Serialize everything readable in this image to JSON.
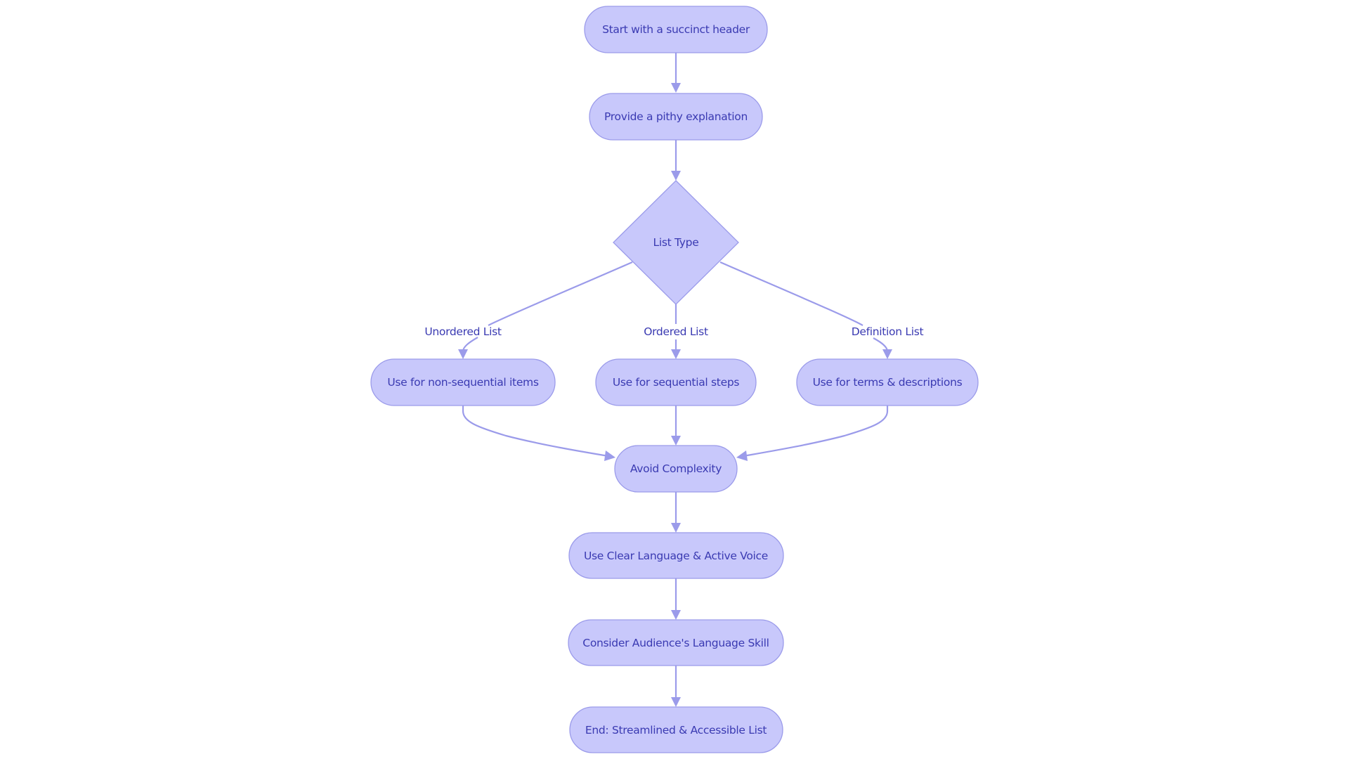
{
  "diagram": {
    "type": "flowchart",
    "direction": "top-down",
    "colors": {
      "node_fill": "#c8c8fb",
      "node_stroke": "#9b9bea",
      "text": "#3a3ab2",
      "edge": "#9b9bea",
      "background": "#ffffff"
    },
    "nodes": [
      {
        "id": "start",
        "label": "Start with a succinct header",
        "shape": "stadium"
      },
      {
        "id": "pithy",
        "label": "Provide a pithy explanation",
        "shape": "stadium"
      },
      {
        "id": "listtype",
        "label": "List Type",
        "shape": "diamond"
      },
      {
        "id": "nonseq",
        "label": "Use for non-sequential items",
        "shape": "stadium"
      },
      {
        "id": "seq",
        "label": "Use for sequential steps",
        "shape": "stadium"
      },
      {
        "id": "terms",
        "label": "Use for terms & descriptions",
        "shape": "stadium"
      },
      {
        "id": "avoid",
        "label": "Avoid Complexity",
        "shape": "stadium"
      },
      {
        "id": "clear",
        "label": "Use Clear Language & Active Voice",
        "shape": "stadium"
      },
      {
        "id": "audience",
        "label": "Consider Audience's Language Skill",
        "shape": "stadium"
      },
      {
        "id": "end",
        "label": "End: Streamlined & Accessible List",
        "shape": "stadium"
      }
    ],
    "edges": [
      {
        "from": "start",
        "to": "pithy",
        "label": ""
      },
      {
        "from": "pithy",
        "to": "listtype",
        "label": ""
      },
      {
        "from": "listtype",
        "to": "nonseq",
        "label": "Unordered List"
      },
      {
        "from": "listtype",
        "to": "seq",
        "label": "Ordered List"
      },
      {
        "from": "listtype",
        "to": "terms",
        "label": "Definition List"
      },
      {
        "from": "nonseq",
        "to": "avoid",
        "label": ""
      },
      {
        "from": "seq",
        "to": "avoid",
        "label": ""
      },
      {
        "from": "terms",
        "to": "avoid",
        "label": ""
      },
      {
        "from": "avoid",
        "to": "clear",
        "label": ""
      },
      {
        "from": "clear",
        "to": "audience",
        "label": ""
      },
      {
        "from": "audience",
        "to": "end",
        "label": ""
      }
    ]
  }
}
